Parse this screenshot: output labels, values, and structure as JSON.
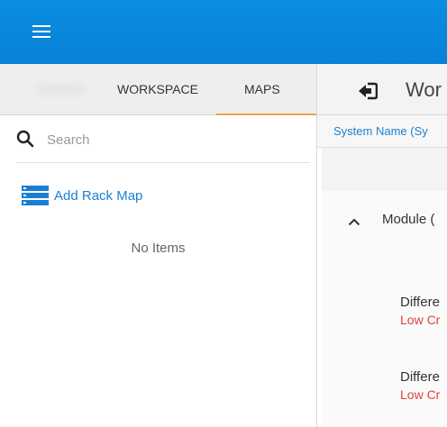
{
  "topbar": {
    "menu_icon": "hamburger-menu-icon",
    "color": "#0a8ee0"
  },
  "left_panel": {
    "tabs": [
      {
        "label": "WORKSPACE",
        "active": false
      },
      {
        "label": "MAPS",
        "active": true
      }
    ],
    "active_tab_color": "#f0a24a",
    "search": {
      "placeholder": "Search",
      "value": ""
    },
    "add_rack_map": {
      "label": "Add Rack Map",
      "icon": "rack-list-icon"
    },
    "empty_text": "No Items"
  },
  "right_panel": {
    "header": {
      "back_icon": "exit-icon",
      "title": "Wor"
    },
    "system_name": "System Name (Sy",
    "module": "Module (",
    "items": [
      {
        "title": "Differe",
        "status": "Low Cr"
      },
      {
        "title": "Differe",
        "status": "Low Cr"
      }
    ],
    "link_color": "#1a7fd4",
    "alert_color": "#e0413e"
  }
}
